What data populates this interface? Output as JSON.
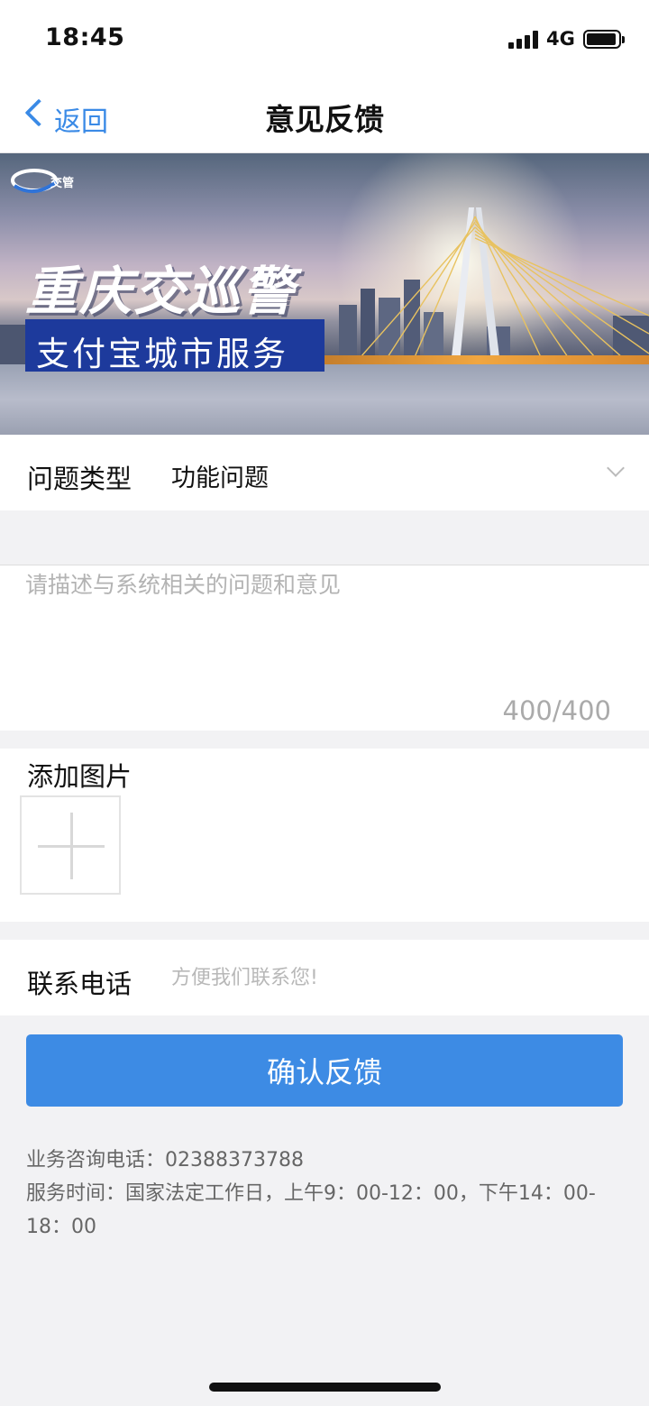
{
  "status_bar": {
    "time": "18:45",
    "network": "4G"
  },
  "nav": {
    "back_label": "返回",
    "title": "意见反馈"
  },
  "banner": {
    "logo_text": "交管",
    "title": "重庆交巡警",
    "subtitle": "支付宝城市服务"
  },
  "form": {
    "type_label": "问题类型",
    "type_value": "功能问题",
    "description_placeholder": "请描述与系统相关的问题和意见",
    "char_count": "400/400",
    "image_label": "添加图片",
    "phone_label": "联系电话",
    "phone_placeholder": "方便我们联系您!"
  },
  "submit_label": "确认反馈",
  "info": {
    "line1": "业务咨询电话：02388373788",
    "line2": "服务时间：国家法定工作日，上午9：00-12：00，下午14：00-18：00"
  },
  "colors": {
    "accent": "#3d8be4",
    "link": "#3a8ae6",
    "page_bg": "#f2f2f4"
  }
}
